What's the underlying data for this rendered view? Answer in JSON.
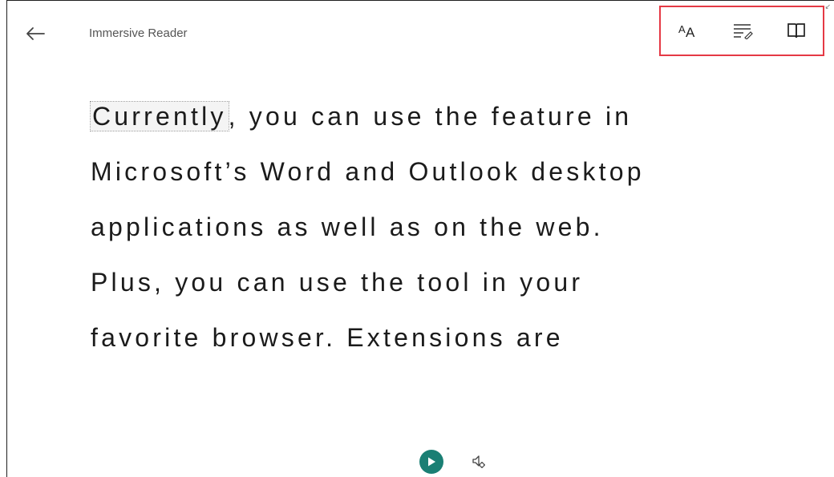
{
  "header": {
    "back_icon": "arrow-left-icon",
    "title": "Immersive Reader"
  },
  "toolbar": {
    "highlight_color": "#e53945",
    "buttons": [
      {
        "icon": "text-preferences-icon",
        "glyph_a": "A",
        "glyph_b": "A"
      },
      {
        "icon": "grammar-options-icon"
      },
      {
        "icon": "reading-preferences-icon"
      }
    ]
  },
  "reader": {
    "lines": [
      {
        "highlighted_word": "Currently",
        "rest": ", you can use the feature in"
      },
      {
        "text": "Microsoft’s Word and Outlook desktop"
      },
      {
        "text": "applications as well as on the web."
      },
      {
        "text": "Plus, you can use the tool in your"
      },
      {
        "text": "favorite browser. Extensions are"
      }
    ]
  },
  "playback": {
    "play_icon": "play-icon",
    "play_color": "#1a7f74",
    "voice_settings_icon": "voice-settings-icon"
  }
}
